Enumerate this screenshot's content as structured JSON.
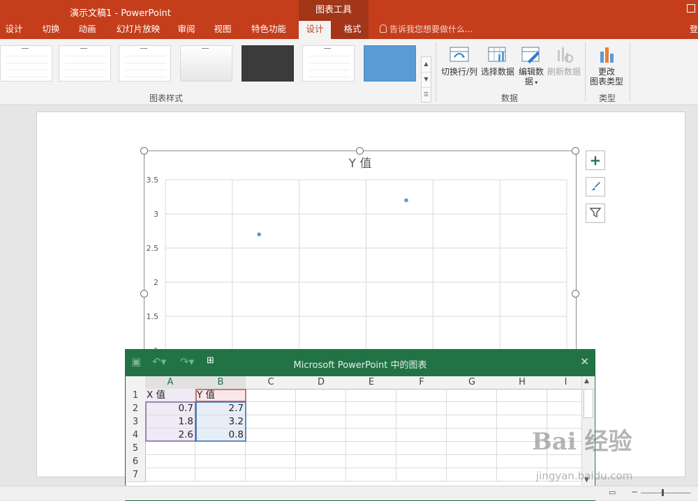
{
  "titlebar": {
    "title": "演示文稿1 - PowerPoint",
    "context_tab": "图表工具"
  },
  "tabs": [
    {
      "label": "设计"
    },
    {
      "label": "切换"
    },
    {
      "label": "动画"
    },
    {
      "label": "幻灯片放映"
    },
    {
      "label": "审阅"
    },
    {
      "label": "视图"
    },
    {
      "label": "特色功能"
    },
    {
      "label": "设计"
    },
    {
      "label": "格式"
    }
  ],
  "tell_me": "告诉我您想要做什么...",
  "edge_char": "登",
  "ribbon": {
    "chart_styles_label": "图表样式",
    "data_group_label": "数据",
    "type_group_label": "类型",
    "switch_row_col": "切换行/列",
    "select_data": "选择数据",
    "edit_data": "编辑数",
    "edit_data_line2": "据",
    "refresh_data": "刷新数据",
    "change_type_line1": "更改",
    "change_type_line2": "图表类型"
  },
  "chart_data": {
    "type": "scatter",
    "title": "Y 值",
    "y_ticks": [
      "3.5",
      "3",
      "2.5",
      "2",
      "1.5",
      "1"
    ],
    "ylim": [
      0,
      3.5
    ],
    "grid": true,
    "series": [
      {
        "name": "Y 值",
        "x": [
          0.7,
          1.8,
          2.6
        ],
        "y": [
          2.7,
          3.2,
          0.8
        ]
      }
    ],
    "point_color": "#5b9bd5"
  },
  "spreadsheet": {
    "title": "Microsoft PowerPoint 中的图表",
    "columns": [
      "A",
      "B",
      "C",
      "D",
      "E",
      "F",
      "G",
      "H",
      "I"
    ],
    "rows": [
      "1",
      "2",
      "3",
      "4",
      "5",
      "6",
      "7"
    ],
    "cells": {
      "A1": "X 值",
      "B1": "Y 值",
      "A2": "0.7",
      "B2": "2.7",
      "A3": "1.8",
      "B3": "3.2",
      "A4": "2.6",
      "B4": "0.8"
    }
  },
  "watermark": {
    "text": "Bai 经验",
    "sub": "jingyan.baidu.com"
  },
  "colors": {
    "accent": "#c43e1c",
    "excel_green": "#217346"
  }
}
